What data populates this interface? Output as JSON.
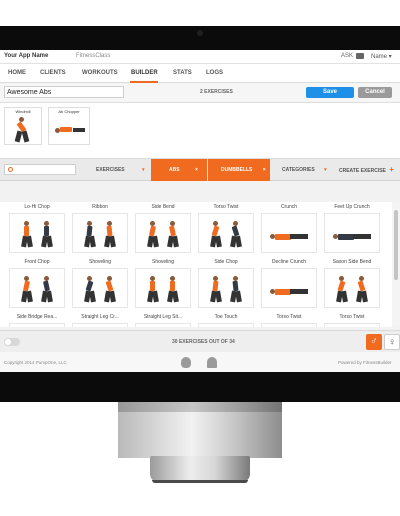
{
  "topbar": {
    "app_name": "Your App Name",
    "client_name": "FitnessClass",
    "ask_label": "ASK",
    "user_label": "Name ▾"
  },
  "nav": {
    "tabs": [
      {
        "label": "HOME"
      },
      {
        "label": "CLIENTS"
      },
      {
        "label": "WORKOUTS"
      },
      {
        "label": "BUILDER"
      },
      {
        "label": "STATS"
      },
      {
        "label": "LOGS"
      }
    ],
    "active": "BUILDER"
  },
  "builder": {
    "workout_name": "Awesome Abs",
    "exercise_count": "2 EXERCISES",
    "save_label": "Save",
    "cancel_label": "Cancel"
  },
  "selected": [
    {
      "label": "Windmill"
    },
    {
      "label": "Ab Chopper"
    }
  ],
  "filters": {
    "exercises_label": "EXERCISES",
    "chip_abs": "ABS",
    "chip_dumbbells": "DUMBBELLS",
    "categories_label": "CATEGORIES",
    "create_label": "CREATE EXERCISE",
    "close_glyph": "×",
    "caret_glyph": "▾",
    "plus_glyph": "+"
  },
  "exercises": [
    {
      "title": "Lo-Hi Chop"
    },
    {
      "title": "Ribbon"
    },
    {
      "title": "Side Bend"
    },
    {
      "title": "Torso Twist"
    },
    {
      "title": "Crunch"
    },
    {
      "title": "Feet Up Crunch"
    },
    {
      "title": "Front Chop"
    },
    {
      "title": "Shoveling"
    },
    {
      "title": "Shoveling"
    },
    {
      "title": "Side Chop"
    },
    {
      "title": "Decline Crunch"
    },
    {
      "title": "Saxon Side Bend"
    },
    {
      "title": "Side Bridge Rea..."
    },
    {
      "title": "Straight Leg Cr..."
    },
    {
      "title": "Straight Leg Sit..."
    },
    {
      "title": "Toe Touch"
    },
    {
      "title": "Torso Twist"
    },
    {
      "title": "Torso Twist"
    }
  ],
  "footer": {
    "count_text": "30 EXERCISES OUT OF 34",
    "male_glyph": "♂",
    "female_glyph": "♀"
  },
  "copyright": {
    "left": "Copyright 2014 PumpOne, LLC",
    "right": "Powered by FitnessBuilder"
  },
  "colors": {
    "accent": "#f06a20",
    "save": "#1e90e8",
    "cancel": "#9a9a9a"
  }
}
